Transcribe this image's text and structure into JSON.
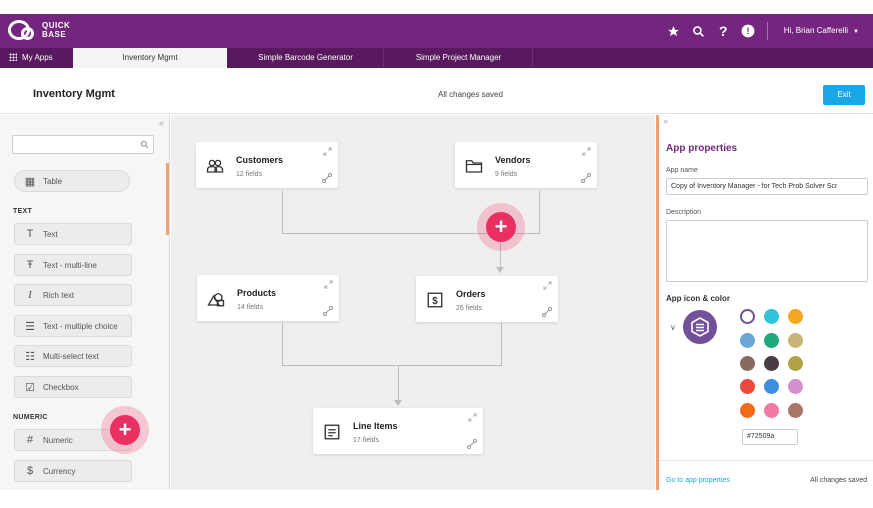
{
  "brand": {
    "line1": "QUICK",
    "line2": "BASE"
  },
  "topbar": {
    "user_label": "Hi, Brian Cafferelli",
    "icons": [
      "star-icon",
      "search-icon",
      "help-icon",
      "alert-icon"
    ],
    "help_glyph": "?",
    "alert_glyph": "!"
  },
  "tabs": {
    "my_apps": "My Apps",
    "items": [
      "Inventory Mgmt",
      "Simple Barcode Generator",
      "Simple Project Manager"
    ]
  },
  "titlebar": {
    "app_title": "Inventory Mgmt",
    "save_status": "All changes saved",
    "exit_label": "Exit"
  },
  "left_panel": {
    "search_placeholder": "",
    "table_item": "Table",
    "sections": {
      "text": "TEXT",
      "numeric": "NUMERIC"
    },
    "text_fields": [
      "Text",
      "Text - multi-line",
      "Rich text",
      "Text - multiple choice",
      "Multi-select text",
      "Checkbox"
    ],
    "numeric_fields": [
      "Numeric",
      "Currency"
    ]
  },
  "canvas": {
    "tables": [
      {
        "name": "Customers",
        "fields": "12 fields",
        "icon": "customers-icon"
      },
      {
        "name": "Vendors",
        "fields": "9 fields",
        "icon": "folder-icon"
      },
      {
        "name": "Products",
        "fields": "14 fields",
        "icon": "shapes-icon"
      },
      {
        "name": "Orders",
        "fields": "26 fields",
        "icon": "dollar-icon"
      },
      {
        "name": "Line Items",
        "fields": "17 fields",
        "icon": "list-icon"
      }
    ],
    "plus_glyph": "+"
  },
  "right_panel": {
    "title": "App properties",
    "app_name_label": "App name",
    "app_name_value": "Copy of Inventory Manager - for Tech Prob Solver Scr",
    "description_label": "Description",
    "icon_color_label": "App icon & color",
    "selected_color": "#72509a",
    "hex_value": "#72509a",
    "swatches": [
      "#72509a",
      "#2ec4dc",
      "#f5a623",
      "#6aa6d6",
      "#1fa87b",
      "#c9b47a",
      "#8a6a5e",
      "#4a3b44",
      "#b2a246",
      "#ea4a3c",
      "#3f8fe0",
      "#d58fd0",
      "#f26b1d",
      "#f07aa3",
      "#a9776a"
    ],
    "go_to_link": "Go to app properties",
    "save_status": "All changes saved"
  },
  "colors": {
    "brand_purple": "#74267f",
    "tab_dark": "#58195f",
    "accent_blue": "#1aa7e8",
    "plus_pink": "#ea2f62",
    "orange_accent": "#f3a070"
  }
}
